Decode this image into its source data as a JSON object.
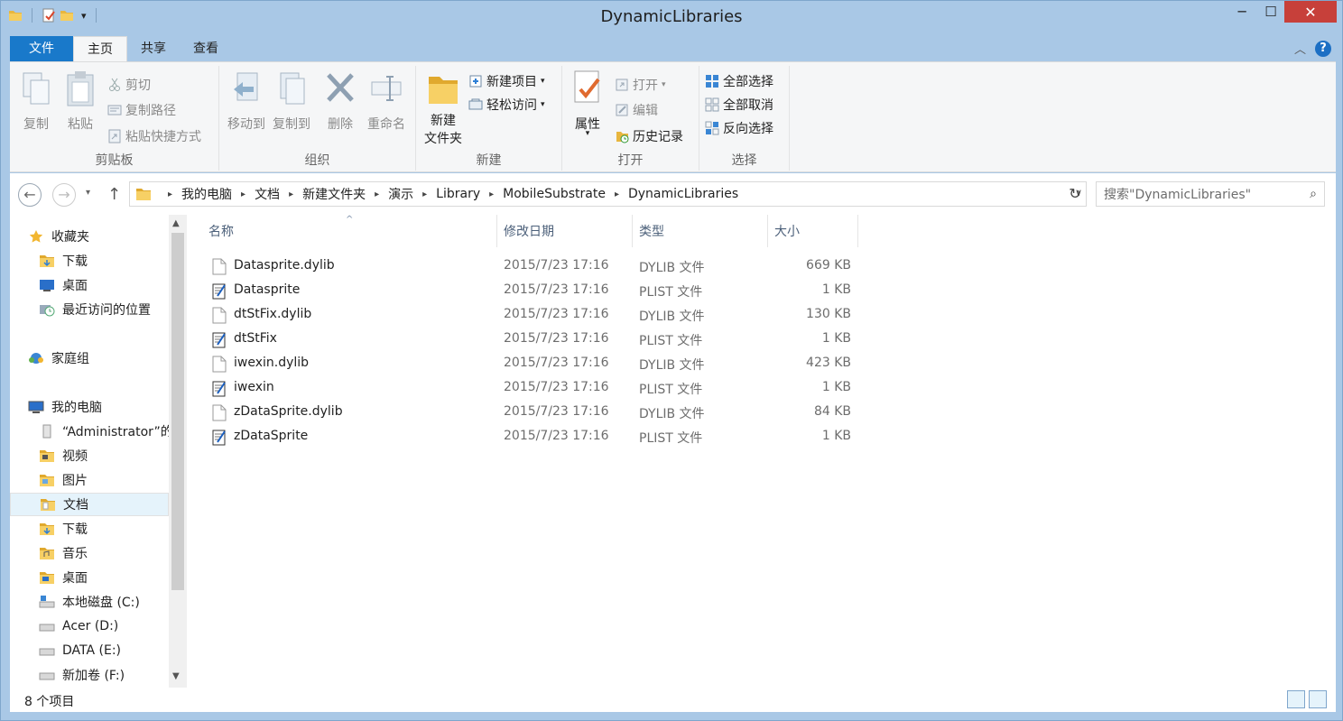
{
  "window": {
    "title": "DynamicLibraries",
    "minimize": "─",
    "maximize": "☐",
    "close": "✕",
    "colors": {
      "frame": "#a9c8e6",
      "accent": "#1979ca",
      "close": "#c7403a"
    }
  },
  "qat": {
    "icons": [
      "folder-icon",
      "properties-icon",
      "new-folder-icon"
    ],
    "dropdown": "▾"
  },
  "tabs": [
    {
      "label": "文件"
    },
    {
      "label": "主页"
    },
    {
      "label": "共享"
    },
    {
      "label": "查看"
    }
  ],
  "ribbon": {
    "clipboard": {
      "label": "剪贴板",
      "copy": "复制",
      "paste": "粘贴",
      "cut": "剪切",
      "copy_path": "复制路径",
      "paste_shortcut": "粘贴快捷方式"
    },
    "organize": {
      "label": "组织",
      "move_to": "移动到",
      "copy_to": "复制到",
      "delete": "删除",
      "rename": "重命名"
    },
    "new": {
      "label": "新建",
      "new_folder_l1": "新建",
      "new_folder_l2": "文件夹",
      "new_item": "新建项目",
      "easy_access": "轻松访问"
    },
    "open": {
      "label": "打开",
      "properties": "属性",
      "open": "打开",
      "edit": "编辑",
      "history": "历史记录"
    },
    "select": {
      "label": "选择",
      "select_all": "全部选择",
      "select_none": "全部取消",
      "invert": "反向选择"
    }
  },
  "navbar": {
    "back": "←",
    "forward": "→",
    "recent": "▾",
    "up": "↑",
    "breadcrumbs": [
      "我的电脑",
      "文档",
      "新建文件夹",
      "演示",
      "Library",
      "MobileSubstrate",
      "DynamicLibraries"
    ],
    "crumb_sep": "▸",
    "dropdown": "∨",
    "refresh": "↻",
    "search_placeholder": "搜索\"DynamicLibraries\"",
    "search_icon": "⌕"
  },
  "navpane": {
    "items": [
      {
        "label": "收藏夹",
        "icon": "star-icon"
      },
      {
        "label": "下载",
        "icon": "download-folder-icon"
      },
      {
        "label": "桌面",
        "icon": "desktop-icon"
      },
      {
        "label": "最近访问的位置",
        "icon": "recent-places-icon"
      },
      {
        "label": "家庭组",
        "icon": "homegroup-icon"
      },
      {
        "label": "我的电脑",
        "icon": "computer-icon"
      },
      {
        "label": "“Administrator”的",
        "icon": "user-folder-icon"
      },
      {
        "label": "视频",
        "icon": "videos-folder-icon"
      },
      {
        "label": "图片",
        "icon": "pictures-folder-icon"
      },
      {
        "label": "文档",
        "icon": "documents-folder-icon"
      },
      {
        "label": "下载",
        "icon": "download-folder-icon"
      },
      {
        "label": "音乐",
        "icon": "music-folder-icon"
      },
      {
        "label": "桌面",
        "icon": "desktop-folder-icon"
      },
      {
        "label": "本地磁盘 (C:)",
        "icon": "system-drive-icon"
      },
      {
        "label": "Acer (D:)",
        "icon": "drive-icon"
      },
      {
        "label": "DATA (E:)",
        "icon": "drive-icon"
      },
      {
        "label": "新加卷 (F:)",
        "icon": "drive-icon"
      }
    ],
    "scroll_up": "▲",
    "scroll_down": "▼"
  },
  "columns": {
    "name": "名称",
    "date": "修改日期",
    "type": "类型",
    "size": "大小",
    "sort_indicator": "^"
  },
  "files": [
    {
      "name": "Datasprite.dylib",
      "date": "2015/7/23 17:16",
      "type": "DYLIB 文件",
      "size": "669 KB",
      "icon": "blank-file-icon"
    },
    {
      "name": "Datasprite",
      "date": "2015/7/23 17:16",
      "type": "PLIST 文件",
      "size": "1 KB",
      "icon": "plist-file-icon"
    },
    {
      "name": "dtStFix.dylib",
      "date": "2015/7/23 17:16",
      "type": "DYLIB 文件",
      "size": "130 KB",
      "icon": "blank-file-icon"
    },
    {
      "name": "dtStFix",
      "date": "2015/7/23 17:16",
      "type": "PLIST 文件",
      "size": "1 KB",
      "icon": "plist-file-icon"
    },
    {
      "name": "iwexin.dylib",
      "date": "2015/7/23 17:16",
      "type": "DYLIB 文件",
      "size": "423 KB",
      "icon": "blank-file-icon"
    },
    {
      "name": "iwexin",
      "date": "2015/7/23 17:16",
      "type": "PLIST 文件",
      "size": "1 KB",
      "icon": "plist-file-icon"
    },
    {
      "name": "zDataSprite.dylib",
      "date": "2015/7/23 17:16",
      "type": "DYLIB 文件",
      "size": "84 KB",
      "icon": "blank-file-icon"
    },
    {
      "name": "zDataSprite",
      "date": "2015/7/23 17:16",
      "type": "PLIST 文件",
      "size": "1 KB",
      "icon": "plist-file-icon"
    }
  ],
  "status": {
    "item_count": "8 个项目"
  }
}
